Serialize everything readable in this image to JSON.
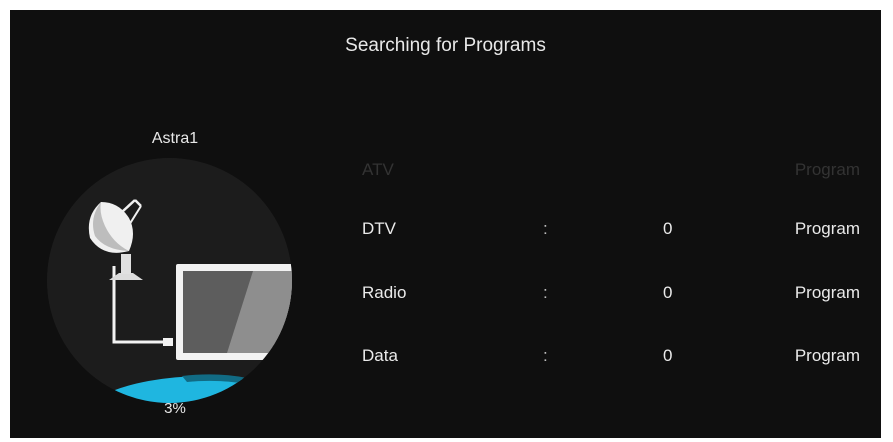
{
  "header": {
    "title": "Searching for Programs"
  },
  "satellite": {
    "name": "Astra1",
    "progress_text": "3%",
    "progress": 0.03
  },
  "rows": [
    {
      "label": "ATV",
      "separator": "",
      "count": "",
      "unit": "Program",
      "dim": true
    },
    {
      "label": "DTV",
      "separator": ":",
      "count": "0",
      "unit": "Program",
      "dim": false
    },
    {
      "label": "Radio",
      "separator": ":",
      "count": "0",
      "unit": "Program",
      "dim": false
    },
    {
      "label": "Data",
      "separator": ":",
      "count": "0",
      "unit": "Program",
      "dim": false
    }
  ],
  "colors": {
    "background": "#0f0f0f",
    "progress": "#1fb6e0",
    "text": "#eaeaea"
  },
  "icons": {
    "illustration": [
      "satellite-dish-icon",
      "tv-monitor-icon"
    ]
  }
}
